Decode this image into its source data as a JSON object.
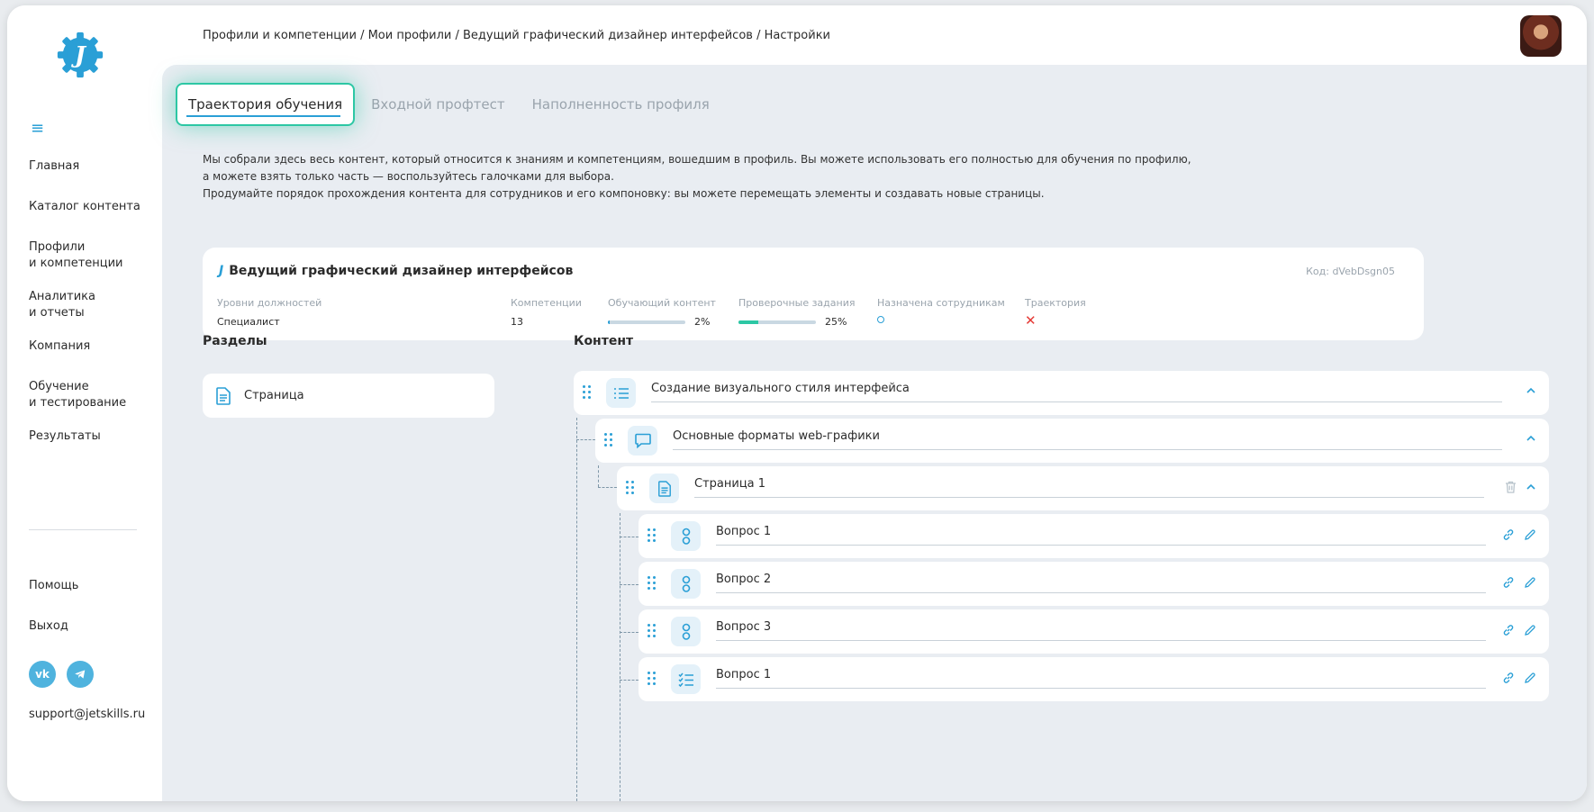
{
  "sidebar": {
    "nav": [
      {
        "label": "Главная"
      },
      {
        "label": "Каталог контента"
      },
      {
        "label": "Профили\nи компетенции"
      },
      {
        "label": "Аналитика\nи отчеты"
      },
      {
        "label": "Компания"
      },
      {
        "label": "Обучение\nи тестирование"
      },
      {
        "label": "Результаты"
      }
    ],
    "help": "Помощь",
    "logout": "Выход",
    "socials": [
      {
        "icon": "vk-icon",
        "text": "vk"
      },
      {
        "icon": "telegram-icon",
        "text": ""
      }
    ],
    "support_email": "support@jetskills.ru"
  },
  "header": {
    "breadcrumb": "Профили и компетенции / Мои профили / Ведущий графический дизайнер интерфейсов / Настройки"
  },
  "tabs": [
    {
      "label": "Траектория обучения",
      "active": true
    },
    {
      "label": "Входной профтест",
      "active": false
    },
    {
      "label": "Наполненность профиля",
      "active": false
    }
  ],
  "description": {
    "line1": "Мы собрали здесь весь контент, который относится к знаниям и компетенциям, вошедшим в профиль. Вы можете использовать его полностью для обучения по профилю,",
    "line2": "а можете взять только часть — воспользуйтесь галочками для выбора.",
    "line3": "Продумайте порядок прохождения контента для сотрудников и его компоновку: вы можете перемещать элементы и создавать новые страницы."
  },
  "profile": {
    "logo_letter": "J",
    "title": "Ведущий графический дизайнер интерфейсов",
    "code": "Код: dVebDsgn05",
    "levels_label": "Уровни должностей",
    "levels_value": "Специалист",
    "competencies_label": "Компетенции",
    "competencies_value": "13",
    "training_label": "Обучающий контент",
    "training_value": "2%",
    "training_fraction": 0.02,
    "tasks_label": "Проверочные задания",
    "tasks_value": "25%",
    "tasks_fraction": 0.25,
    "assigned_label": "Назначена сотрудникам",
    "trajectory_label": "Траектория",
    "colors": {
      "training": "#2a9fd6",
      "tasks": "#2cc7a4",
      "cross": "#e53935"
    }
  },
  "sections": {
    "title": "Разделы",
    "items": [
      {
        "label": "Страница",
        "icon": "document-icon"
      }
    ]
  },
  "content": {
    "title": "Контент",
    "tree": [
      {
        "label": "Создание визуального стиля интерфейса",
        "icon": "list-icon",
        "level": 0,
        "actions": [
          "chevron-up-icon"
        ]
      },
      {
        "label": "Основные форматы web-графики",
        "icon": "chat-icon",
        "level": 1,
        "actions": [
          "chevron-up-icon"
        ]
      },
      {
        "label": "Страница 1",
        "icon": "document-icon",
        "level": 2,
        "actions": [
          "trash-icon",
          "chevron-up-icon"
        ]
      },
      {
        "label": "Вопрос 1",
        "icon": "question-icon",
        "level": 3,
        "actions": [
          "link-icon",
          "pencil-icon"
        ]
      },
      {
        "label": "Вопрос 2",
        "icon": "question-icon",
        "level": 3,
        "actions": [
          "link-icon",
          "pencil-icon"
        ]
      },
      {
        "label": "Вопрос 3",
        "icon": "question-icon",
        "level": 3,
        "actions": [
          "link-icon",
          "pencil-icon"
        ]
      },
      {
        "label": "Вопрос 1",
        "icon": "checklist-icon",
        "level": 3,
        "actions": [
          "link-icon",
          "pencil-icon"
        ]
      }
    ]
  },
  "accent": "#2a9fd6"
}
